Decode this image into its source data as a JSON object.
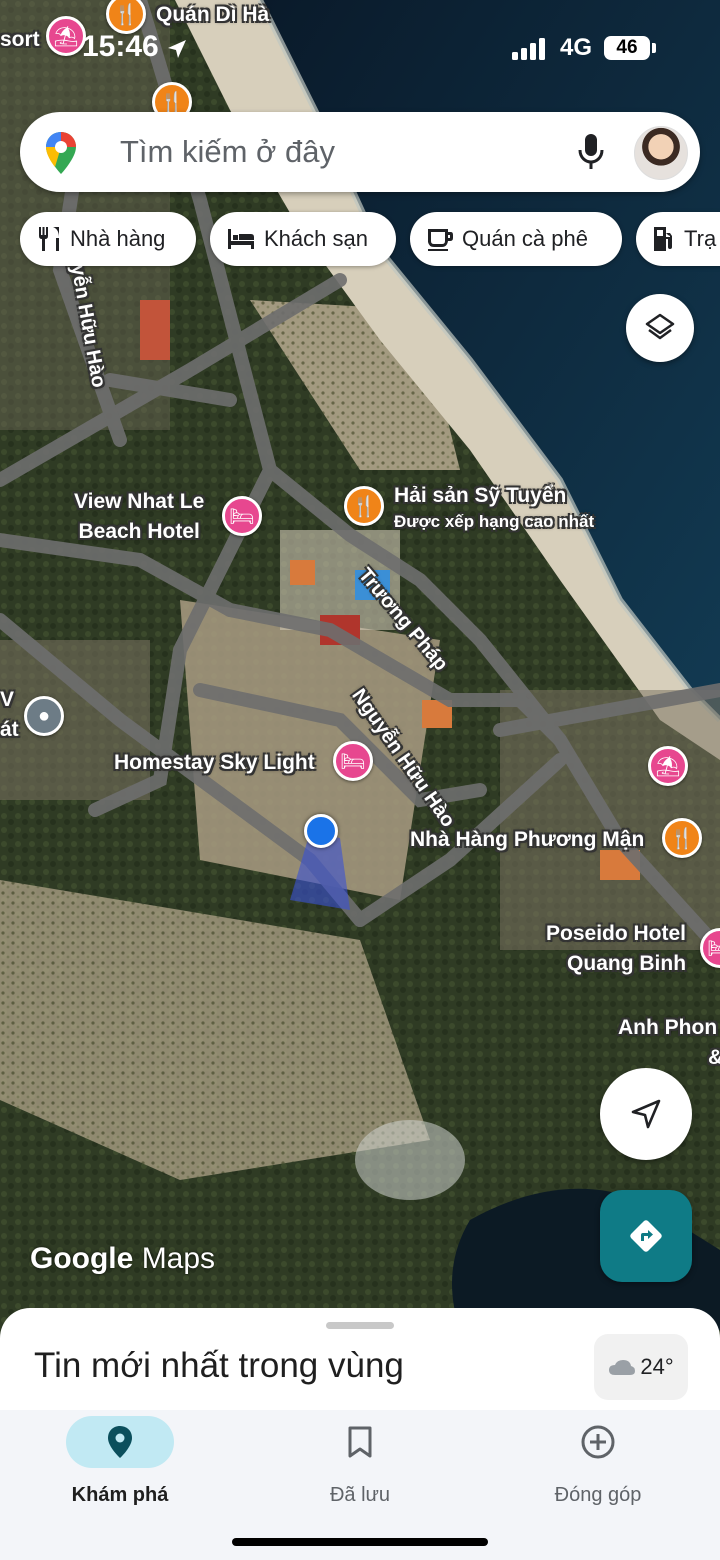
{
  "status_bar": {
    "time": "15:46",
    "network": "4G",
    "battery": "46"
  },
  "search": {
    "placeholder": "Tìm kiếm ở đây"
  },
  "chips": [
    {
      "label": "Nhà hàng",
      "icon": "fork-knife-icon"
    },
    {
      "label": "Khách sạn",
      "icon": "bed-icon"
    },
    {
      "label": "Quán cà phê",
      "icon": "coffee-cup-icon"
    },
    {
      "label": "Trạ",
      "icon": "fuel-pump-icon"
    }
  ],
  "map": {
    "pois": {
      "quan_di_ha": "Quán Dì Hà",
      "resort_partial": "sort",
      "view_nhat_le_line1": "View Nhat Le",
      "view_nhat_le_line2": "Beach Hotel",
      "hai_san": "Hải sản Sỹ Tuyển",
      "hai_san_sub": "Được xếp hạng cao nhất",
      "homestay": "Homestay Sky Light",
      "nha_hang_phuong_man": "Nhà Hàng Phương Mận",
      "poseido_line1": "Poseido Hotel",
      "poseido_line2": "Quang Binh",
      "anh_phon": "Anh Phon",
      "anh_phon_amp": "&",
      "left_v": "V",
      "left_at": "át"
    },
    "streets": {
      "truong_phap": "Trương Pháp",
      "nguyen_huu_hao": "Nguyễn Hữu Hào",
      "nguyen_huu_hao_top": "Nguyễn Hữu Hào"
    },
    "watermark": {
      "google": "Google",
      "maps": "Maps"
    },
    "accent_colors": {
      "food_pin": "#f08418",
      "hotel_pin": "#e7478f",
      "user_location": "#1a73e8"
    }
  },
  "sheet": {
    "title": "Tin mới nhất trong vùng",
    "weather": "24°"
  },
  "nav": [
    {
      "label": "Khám phá",
      "icon": "location-pin-icon",
      "active": true
    },
    {
      "label": "Đã lưu",
      "icon": "bookmark-icon",
      "active": false
    },
    {
      "label": "Đóng góp",
      "icon": "plus-circle-icon",
      "active": false
    }
  ]
}
